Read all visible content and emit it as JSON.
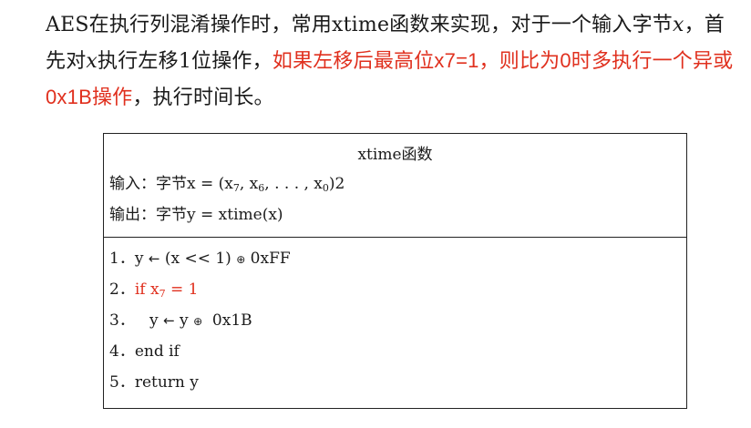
{
  "paragraph": {
    "seg1": "AES在执行列混淆操作时，常用xtime函数来实现，对于一个输入字节",
    "var1": "x",
    "seg2": "，首先对",
    "var2": "x",
    "seg3": "执行左移1位操作，",
    "red": "如果左移后最高位x7=1，则比为0时多执行一个异或0x1B操作",
    "seg4": "，执行时间长。"
  },
  "algorithm": {
    "title": "xtime函数",
    "input": {
      "label": "输入：",
      "text": "字节x = (x",
      "sub7": "7",
      "sep1": ", x",
      "sub6": "6",
      "mid": ", . . . , x",
      "sub0": "0",
      "end": ")2"
    },
    "output": {
      "label": "输出：",
      "text": "字节y = xtime(x)"
    },
    "steps": {
      "s1": {
        "num": "1．",
        "a": "y ",
        "arrow": "←",
        "b": " (x << 1) ",
        "op": "⊕",
        "c": " 0xFF"
      },
      "s2": {
        "num": "2．",
        "a": "if x",
        "sub": "7",
        "b": " = 1"
      },
      "s3": {
        "num": "3．",
        "a": "   y ",
        "arrow": "←",
        "b": " y ",
        "op": "⊕",
        "c": "  0x1B"
      },
      "s4": {
        "num": "4．",
        "a": "end if"
      },
      "s5": {
        "num": "5．",
        "a": "return y"
      }
    }
  },
  "colors": {
    "highlight": "#e0301e",
    "text": "#1a1a1a",
    "border": "#222222"
  }
}
